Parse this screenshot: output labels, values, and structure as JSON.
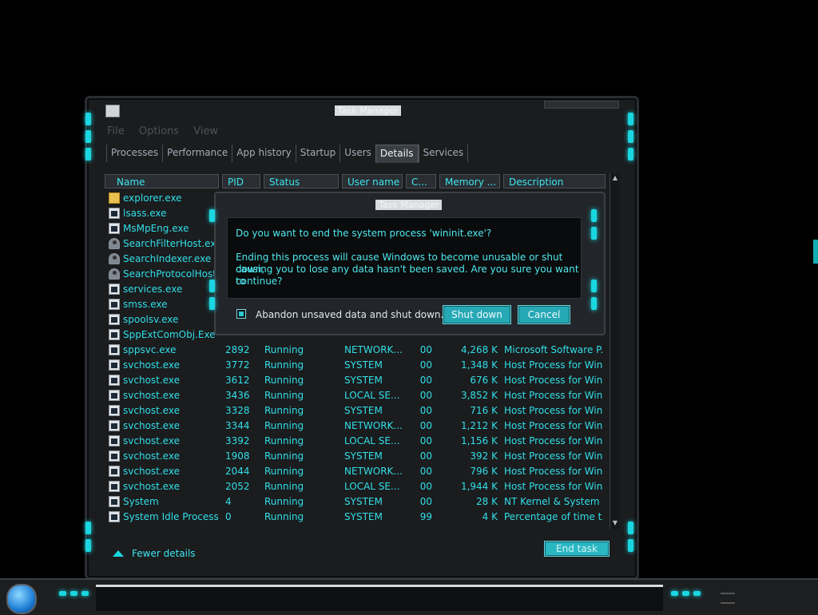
{
  "window": {
    "title": "Task Manager",
    "menu": [
      "File",
      "Options",
      "View"
    ],
    "tabs": [
      "Processes",
      "Performance",
      "App history",
      "Startup",
      "Users",
      "Details",
      "Services"
    ],
    "active_tab": "Details",
    "columns": [
      "Name",
      "PID",
      "Status",
      "User name",
      "C...",
      "Memory ...",
      "Description"
    ],
    "rows": [
      {
        "name": "explorer.exe",
        "pid": "",
        "status": "",
        "user": "",
        "cpu": "",
        "mem": "",
        "desc": "",
        "icon": "folder"
      },
      {
        "name": "lsass.exe",
        "pid": "",
        "status": "",
        "user": "",
        "cpu": "",
        "mem": "",
        "desc": "",
        "icon": "app"
      },
      {
        "name": "MsMpEng.exe",
        "pid": "",
        "status": "",
        "user": "",
        "cpu": "",
        "mem": "",
        "desc": "",
        "icon": "app"
      },
      {
        "name": "SearchFilterHost.exe",
        "pid": "",
        "status": "",
        "user": "",
        "cpu": "",
        "mem": "",
        "desc": "",
        "icon": "user"
      },
      {
        "name": "SearchIndexer.exe",
        "pid": "",
        "status": "",
        "user": "",
        "cpu": "",
        "mem": "",
        "desc": "",
        "icon": "user"
      },
      {
        "name": "SearchProtocolHost...",
        "pid": "",
        "status": "",
        "user": "",
        "cpu": "",
        "mem": "",
        "desc": "",
        "icon": "user"
      },
      {
        "name": "services.exe",
        "pid": "",
        "status": "",
        "user": "",
        "cpu": "",
        "mem": "",
        "desc": "",
        "icon": "app"
      },
      {
        "name": "smss.exe",
        "pid": "",
        "status": "",
        "user": "",
        "cpu": "",
        "mem": "",
        "desc": "",
        "icon": "app"
      },
      {
        "name": "spoolsv.exe",
        "pid": "",
        "status": "",
        "user": "",
        "cpu": "",
        "mem": "",
        "desc": "",
        "icon": "app"
      },
      {
        "name": "SppExtComObj.Exe",
        "pid": "",
        "status": "",
        "user": "",
        "cpu": "",
        "mem": "",
        "desc": "",
        "icon": "app"
      },
      {
        "name": "sppsvc.exe",
        "pid": "2892",
        "status": "Running",
        "user": "NETWORK...",
        "cpu": "00",
        "mem": "4,268 K",
        "desc": "Microsoft Software P...",
        "icon": "app"
      },
      {
        "name": "svchost.exe",
        "pid": "3772",
        "status": "Running",
        "user": "SYSTEM",
        "cpu": "00",
        "mem": "1,348 K",
        "desc": "Host Process for Win...",
        "icon": "app"
      },
      {
        "name": "svchost.exe",
        "pid": "3612",
        "status": "Running",
        "user": "SYSTEM",
        "cpu": "00",
        "mem": "676 K",
        "desc": "Host Process for Win...",
        "icon": "app"
      },
      {
        "name": "svchost.exe",
        "pid": "3436",
        "status": "Running",
        "user": "LOCAL SE...",
        "cpu": "00",
        "mem": "3,852 K",
        "desc": "Host Process for Win...",
        "icon": "app"
      },
      {
        "name": "svchost.exe",
        "pid": "3328",
        "status": "Running",
        "user": "SYSTEM",
        "cpu": "00",
        "mem": "716 K",
        "desc": "Host Process for Win...",
        "icon": "app"
      },
      {
        "name": "svchost.exe",
        "pid": "3344",
        "status": "Running",
        "user": "NETWORK...",
        "cpu": "00",
        "mem": "1,212 K",
        "desc": "Host Process for Win...",
        "icon": "app"
      },
      {
        "name": "svchost.exe",
        "pid": "3392",
        "status": "Running",
        "user": "LOCAL SE...",
        "cpu": "00",
        "mem": "1,156 K",
        "desc": "Host Process for Win...",
        "icon": "app"
      },
      {
        "name": "svchost.exe",
        "pid": "1908",
        "status": "Running",
        "user": "SYSTEM",
        "cpu": "00",
        "mem": "392 K",
        "desc": "Host Process for Win...",
        "icon": "app"
      },
      {
        "name": "svchost.exe",
        "pid": "2044",
        "status": "Running",
        "user": "NETWORK...",
        "cpu": "00",
        "mem": "796 K",
        "desc": "Host Process for Win...",
        "icon": "app"
      },
      {
        "name": "svchost.exe",
        "pid": "2052",
        "status": "Running",
        "user": "LOCAL SE...",
        "cpu": "00",
        "mem": "1,944 K",
        "desc": "Host Process for Win...",
        "icon": "app"
      },
      {
        "name": "System",
        "pid": "4",
        "status": "Running",
        "user": "SYSTEM",
        "cpu": "00",
        "mem": "28 K",
        "desc": "NT Kernel & System",
        "icon": "app"
      },
      {
        "name": "System Idle Process",
        "pid": "0",
        "status": "Running",
        "user": "SYSTEM",
        "cpu": "99",
        "mem": "4 K",
        "desc": "Percentage of time t...",
        "icon": "app"
      }
    ],
    "fewer_details": "Fewer details",
    "end_task": "End task"
  },
  "dialog": {
    "title": "Task Manager",
    "question": "Do you want to end the system process 'wininit.exe'?",
    "warning_line1": "Ending this process will cause Windows to become unusable or shut down,",
    "warning_line2": "causing you to lose any data hasn't been saved. Are you sure you want to",
    "warning_line3": "continue?",
    "checkbox_label": "Abandon unsaved data and shut down.",
    "shutdown_button": "Shut down",
    "cancel_button": "Cancel"
  },
  "colors": {
    "accent": "#1ad6e0",
    "text": "#32dfe8",
    "button": "#26a8b5"
  }
}
